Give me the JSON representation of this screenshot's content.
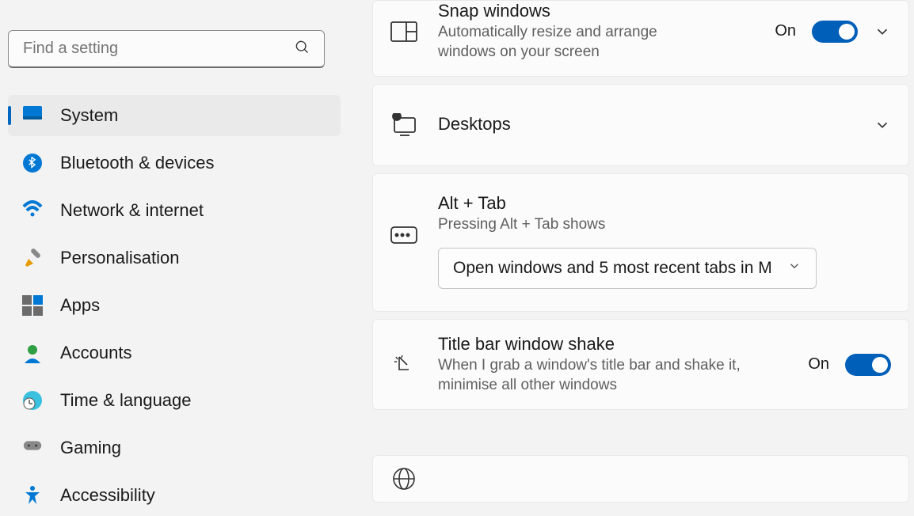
{
  "search": {
    "placeholder": "Find a setting"
  },
  "nav": {
    "items": [
      {
        "label": "System"
      },
      {
        "label": "Bluetooth & devices"
      },
      {
        "label": "Network & internet"
      },
      {
        "label": "Personalisation"
      },
      {
        "label": "Apps"
      },
      {
        "label": "Accounts"
      },
      {
        "label": "Time & language"
      },
      {
        "label": "Gaming"
      },
      {
        "label": "Accessibility"
      }
    ]
  },
  "cards": {
    "snap": {
      "title": "Snap windows",
      "sub": "Automatically resize and arrange windows on your screen",
      "state": "On"
    },
    "desktops": {
      "title": "Desktops"
    },
    "alttab": {
      "title": "Alt + Tab",
      "sub": "Pressing Alt + Tab shows",
      "value": "Open windows and 5 most recent tabs in M"
    },
    "shake": {
      "title": "Title bar window shake",
      "sub": "When I grab a window's title bar and shake it, minimise all other windows",
      "state": "On"
    }
  }
}
